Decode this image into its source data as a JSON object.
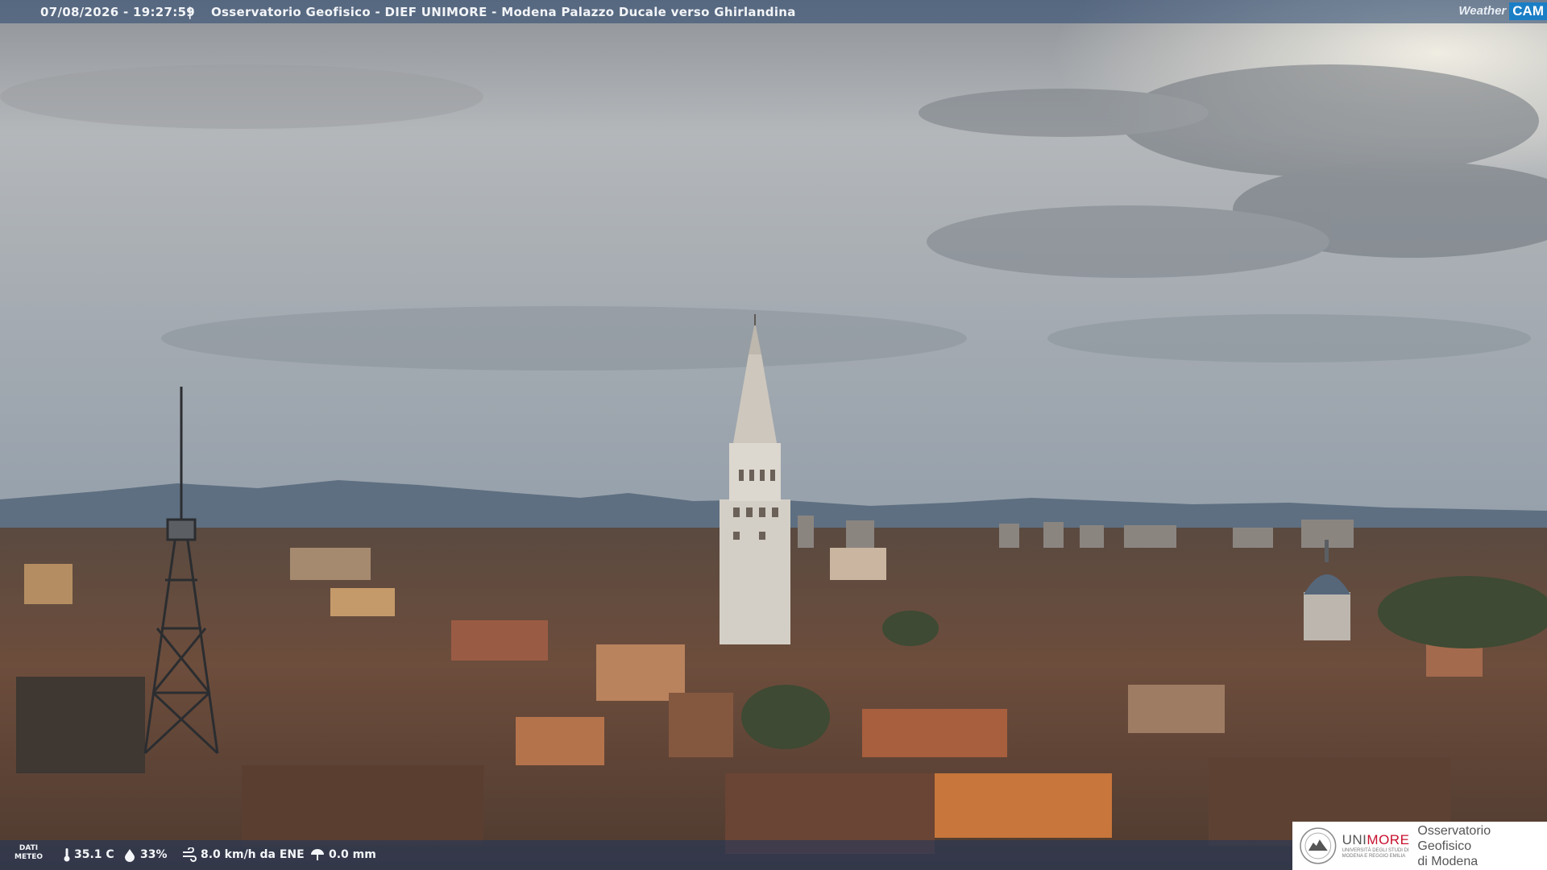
{
  "header": {
    "timestamp": "07/08/2026 - 19:27:59",
    "separator": "|",
    "camera_title": "Osservatorio Geofisico - DIEF UNIMORE - Modena Palazzo Ducale verso Ghirlandina"
  },
  "logo": {
    "weather_text": "Weather",
    "cam_text": "CAM"
  },
  "meteo": {
    "label_line1": "DATI",
    "label_line2": "METEO",
    "temperature": "35.1 C",
    "humidity": "33%",
    "wind": "8.0 km/h da ENE",
    "rain": "0.0 mm"
  },
  "badge": {
    "uni_prefix": "UNI",
    "uni_suffix": "MORE",
    "uni_sub_line1": "UNIVERSITÀ DEGLI STUDI DI",
    "uni_sub_line2": "MODENA E REGGIO EMILIA",
    "obs_line1": "Osservatorio Geofisico",
    "obs_line2": "di Modena"
  },
  "colors": {
    "sky_top": "#8d9196",
    "sky_mid": "#b9bdc0",
    "sky_horizon": "#9aa3ad",
    "mountains": "#5d6f82",
    "roofs": "#6e4b3a",
    "tower": "#d9d4cc",
    "accent_unimore": "#c8102e",
    "accent_weathercam": "#1b7fc6"
  },
  "icons": {
    "temperature": "thermometer-icon",
    "humidity": "droplet-icon",
    "wind": "wind-icon",
    "rain": "rain-gauge-icon"
  }
}
